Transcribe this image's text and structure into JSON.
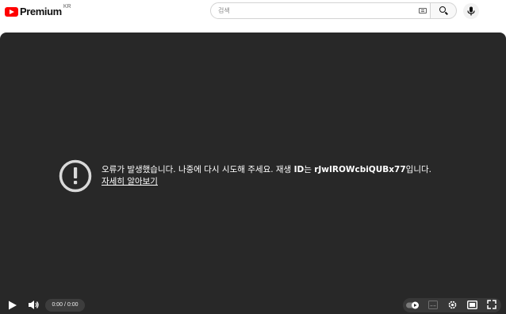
{
  "header": {
    "logo_text": "Premium",
    "region": "KR",
    "search_placeholder": "검색"
  },
  "player": {
    "error_message_prefix": "오류가 발생했습니다. 나중에 다시 시도해 주세요. 재생 ",
    "error_id_label": "ID",
    "error_message_mid": "는 ",
    "error_video_id": "rJwIROWcbiQUBx77",
    "error_message_suffix": "입니다.",
    "learn_more_link": "자세히 알아보기",
    "time_display": "0:00 / 0:00"
  }
}
